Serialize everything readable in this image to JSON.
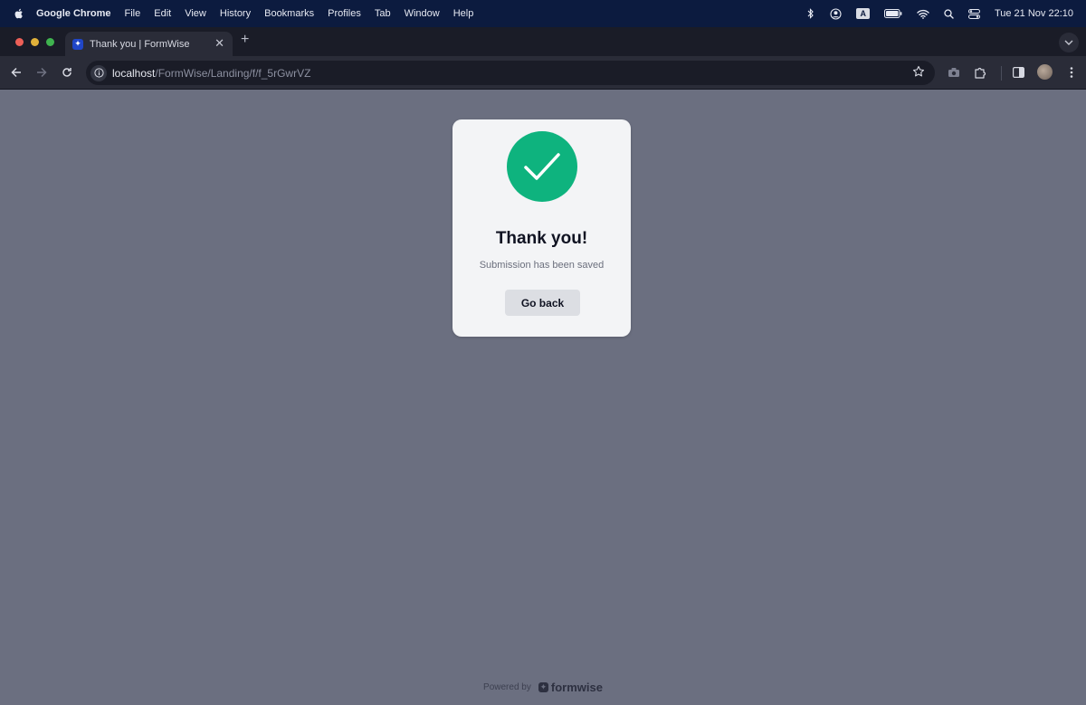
{
  "menubar": {
    "app_name": "Google Chrome",
    "items": [
      "File",
      "Edit",
      "View",
      "History",
      "Bookmarks",
      "Profiles",
      "Tab",
      "Window",
      "Help"
    ],
    "input_source": "A",
    "clock": "Tue 21 Nov  22:10"
  },
  "browser": {
    "tab_title": "Thank you | FormWise",
    "url_host": "localhost",
    "url_path": "/FormWise/Landing/f/f_5rGwrVZ"
  },
  "card": {
    "title": "Thank you!",
    "subtitle": "Submission has been saved",
    "button_label": "Go back",
    "accent_color": "#0eb37e"
  },
  "footer": {
    "powered_by": "Powered by",
    "brand": "formwise"
  },
  "colors": {
    "window_lights": [
      "#ec5f57",
      "#e1b13a",
      "#3fb34f"
    ],
    "page_background": "#6b6f80"
  }
}
